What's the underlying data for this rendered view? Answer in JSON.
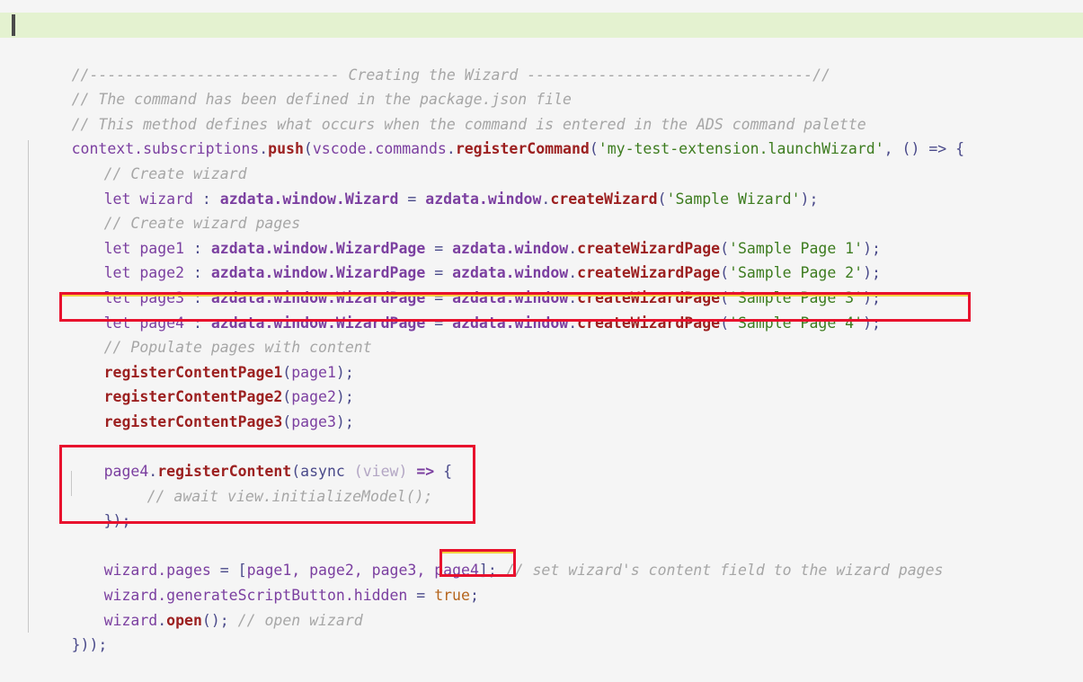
{
  "document": {
    "title": "Creating the Wizard",
    "language": "typescript",
    "background_color": "#f5f5f5",
    "banner_highlight_color": "#e4f2d0",
    "annotation_color": "#e8112d",
    "annotation_inner_color": "#f4d03f"
  },
  "colors": {
    "comment": "#a6a6a6",
    "identifier": "#7b3fa0",
    "function": "#9c2020",
    "string": "#3d7c1f",
    "punctuation": "#4a4a8a",
    "constant": "#b5651d",
    "parameter": "#b3a6c4"
  },
  "banner": {
    "text": "//---------------------------- Creating the Wizard --------------------------------//"
  },
  "code": {
    "line_comment_package": "// The command has been defined in the package.json file",
    "line_comment_method": "// This method defines what occurs when the command is entered in the ADS command palette",
    "register_command": {
      "obj": "context.subscriptions",
      "dot1": ".",
      "push": "push",
      "open_paren": "(",
      "vscode_obj": "vscode.commands",
      "dot2": ".",
      "register": "registerCommand",
      "paren2": "(",
      "command_id": "'my-test-extension.launchWizard'",
      "tail": ", () => {"
    },
    "comment_create_wizard": "// Create wizard",
    "wizard_decl": {
      "let": "let",
      "name": "wizard",
      "colon": " : ",
      "type": "azdata.window.Wizard",
      "equals": " = ",
      "ns": "azdata.window",
      "dot": ".",
      "call": "createWizard",
      "open": "(",
      "arg": "'Sample Wizard'",
      "close": ");"
    },
    "comment_create_pages": "// Create wizard pages",
    "page_decls": [
      {
        "let": "let",
        "name": "page1",
        "colon": " : ",
        "type": "azdata.window.WizardPage",
        "equals": " = ",
        "ns": "azdata.window",
        "dot": ".",
        "call": "createWizardPage",
        "open": "(",
        "arg": "'Sample Page 1'",
        "close": ");"
      },
      {
        "let": "let",
        "name": "page2",
        "colon": " : ",
        "type": "azdata.window.WizardPage",
        "equals": " = ",
        "ns": "azdata.window",
        "dot": ".",
        "call": "createWizardPage",
        "open": "(",
        "arg": "'Sample Page 2'",
        "close": ");"
      },
      {
        "let": "let",
        "name": "page3",
        "colon": " : ",
        "type": "azdata.window.WizardPage",
        "equals": " = ",
        "ns": "azdata.window",
        "dot": ".",
        "call": "createWizardPage",
        "open": "(",
        "arg": "'Sample Page 3'",
        "close": ");"
      },
      {
        "let": "let",
        "name": "page4",
        "colon": " : ",
        "type": "azdata.window.WizardPage",
        "equals": " = ",
        "ns": "azdata.window",
        "dot": ".",
        "call": "createWizardPage",
        "open": "(",
        "arg": "'Sample Page 4'",
        "close": ");"
      }
    ],
    "comment_populate": "// Populate pages with content",
    "register_content_pages": [
      {
        "call": "registerContentPage1",
        "open": "(",
        "arg": "page1",
        "close": ");"
      },
      {
        "call": "registerContentPage2",
        "open": "(",
        "arg": "page2",
        "close": ");"
      },
      {
        "call": "registerContentPage3",
        "open": "(",
        "arg": "page3",
        "close": ");"
      }
    ],
    "page4_register": {
      "obj": "page4",
      "dot": ".",
      "call": "registerContent",
      "open": "(",
      "async": "async",
      "param": " (view)",
      "arrow": " => ",
      "brace": "{",
      "body_comment": "// await view.initializeModel();",
      "closing": "});"
    },
    "wizard_pages_assign": {
      "obj": "wizard.pages",
      "equals": " = ",
      "bracket_open": "[",
      "items": "page1, page2, page3, ",
      "highlighted_item": "page4",
      "bracket_close": "]",
      "semicolon": "; ",
      "comment": "// set wizard's content field to the wizard pages"
    },
    "generate_script_button": {
      "obj": "wizard.generateScriptButton.hidden",
      "equals": " = ",
      "value": "true",
      "semicolon": ";"
    },
    "wizard_open": {
      "obj": "wizard",
      "dot": ".",
      "call": "open",
      "parens": "();",
      "comment": " // open wizard"
    },
    "final_close": "}));"
  },
  "annotations": [
    {
      "name": "page4-declaration-highlight",
      "target": "let page4 : azdata.window.WizardPage = azdata.window.createWizardPage('Sample Page 4');"
    },
    {
      "name": "page4-register-content-highlight",
      "target": "page4.registerContent(async (view) => { ... });"
    },
    {
      "name": "page4-array-entry-highlight",
      "target": "page4]"
    }
  ]
}
